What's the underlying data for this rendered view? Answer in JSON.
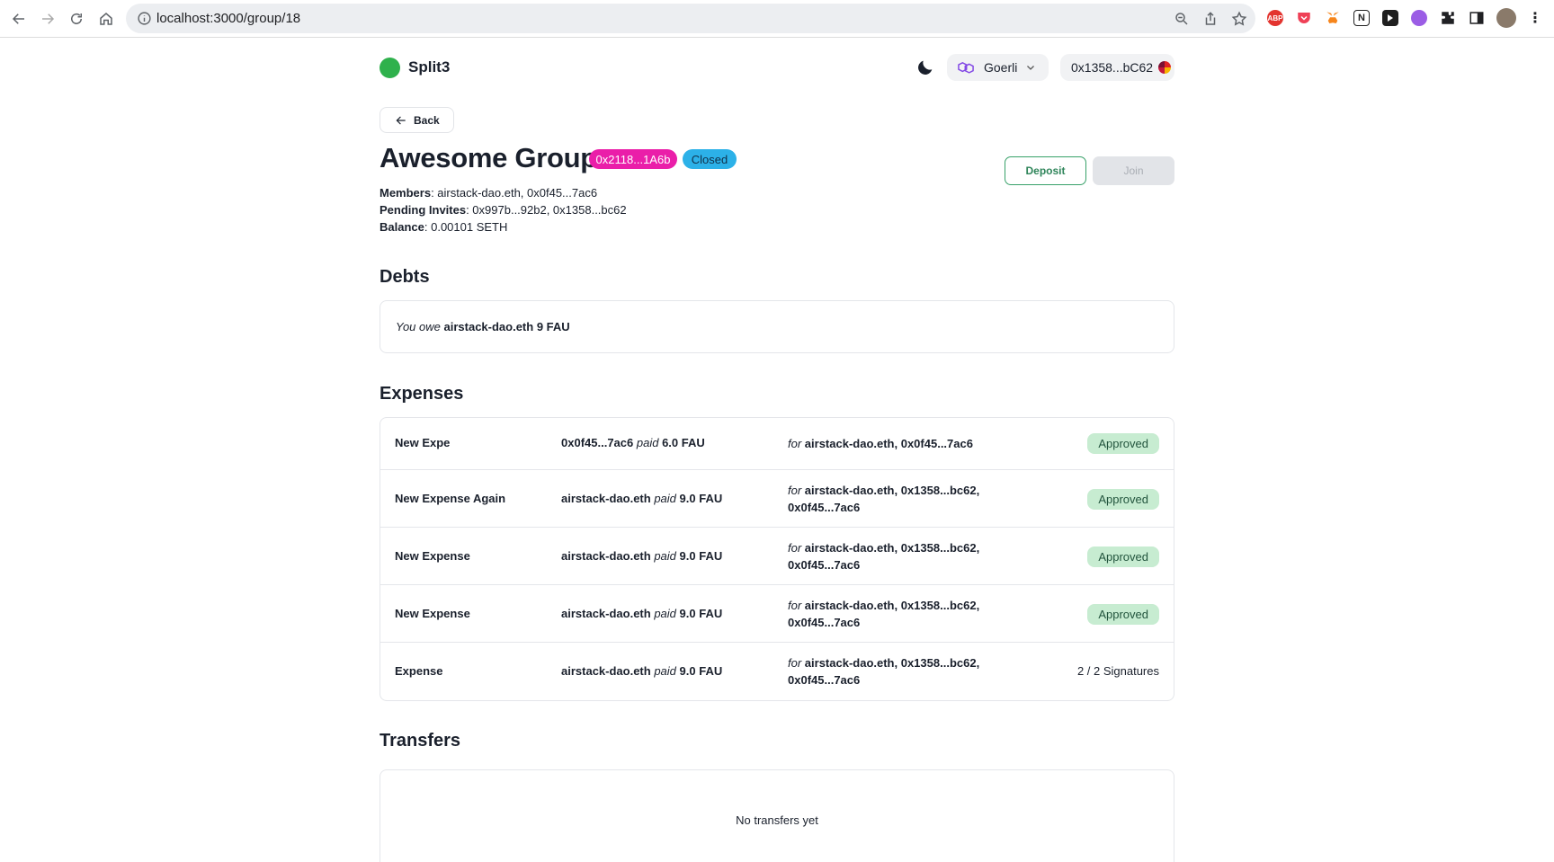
{
  "browser": {
    "url": "localhost:3000/group/18",
    "extensions": [
      "abp-icon",
      "pocket-icon",
      "metamask-icon",
      "notion-icon",
      "cursor-ext-icon",
      "purple-ext-icon",
      "puzzle-icon",
      "sidepanel-icon",
      "profile-avatar"
    ],
    "abp_label": "ABP"
  },
  "header": {
    "app_name": "Split3",
    "network_label": "Goerli",
    "account_label": "0x1358...bC62"
  },
  "back_label": "Back",
  "group": {
    "title": "Awesome Group",
    "address_badge": "0x2118...1A6b",
    "status_badge": "Closed",
    "deposit_label": "Deposit",
    "join_label": "Join",
    "members_key": "Members",
    "members_value": ": airstack-dao.eth, 0x0f45...7ac6",
    "pending_key": "Pending Invites",
    "pending_value": ": 0x997b...92b2, 0x1358...bc62",
    "balance_key": "Balance",
    "balance_value": ": 0.00101 SETH"
  },
  "debts": {
    "title": "Debts",
    "line_prefix": "You owe",
    "line_target": "airstack-dao.eth 9 FAU"
  },
  "expenses": {
    "title": "Expenses",
    "paid_word": "paid",
    "for_word": "for",
    "rows": [
      {
        "name": "New Expe",
        "payer": "0x0f45...7ac6",
        "amount": "6.0 FAU",
        "for_line1": "airstack-dao.eth, 0x0f45...7ac6",
        "for_line2": "",
        "status": "Approved"
      },
      {
        "name": "New Expense Again",
        "payer": "airstack-dao.eth",
        "amount": "9.0 FAU",
        "for_line1": "airstack-dao.eth, 0x1358...bc62,",
        "for_line2": "0x0f45...7ac6",
        "status": "Approved"
      },
      {
        "name": "New Expense",
        "payer": "airstack-dao.eth",
        "amount": "9.0 FAU",
        "for_line1": "airstack-dao.eth, 0x1358...bc62,",
        "for_line2": "0x0f45...7ac6",
        "status": "Approved"
      },
      {
        "name": "New Expense",
        "payer": "airstack-dao.eth",
        "amount": "9.0 FAU",
        "for_line1": "airstack-dao.eth, 0x1358...bc62,",
        "for_line2": "0x0f45...7ac6",
        "status": "Approved"
      },
      {
        "name": "Expense",
        "payer": "airstack-dao.eth",
        "amount": "9.0 FAU",
        "for_line1": "airstack-dao.eth, 0x1358...bc62,",
        "for_line2": "0x0f45...7ac6",
        "status": "2 / 2 Signatures"
      }
    ]
  },
  "transfers": {
    "title": "Transfers",
    "empty_text": "No transfers yet"
  },
  "colors": {
    "brand_green": "#2fb14c",
    "address_badge": "#ea1ea9",
    "closed_badge": "#2cb1e8",
    "approved_bg": "#c7ecd1"
  }
}
